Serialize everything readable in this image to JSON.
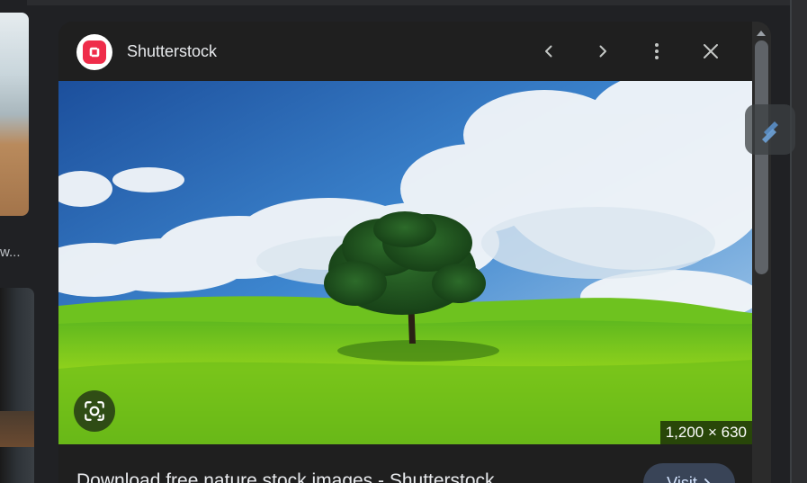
{
  "left": {
    "partial_label": "w..."
  },
  "panel": {
    "site_name": "Shutterstock",
    "image_dimensions": "1,200 × 630",
    "caption": "Download free nature stock images - Shutterstock",
    "visit_label": "Visit",
    "favicon_color": "#ef2c4a"
  }
}
